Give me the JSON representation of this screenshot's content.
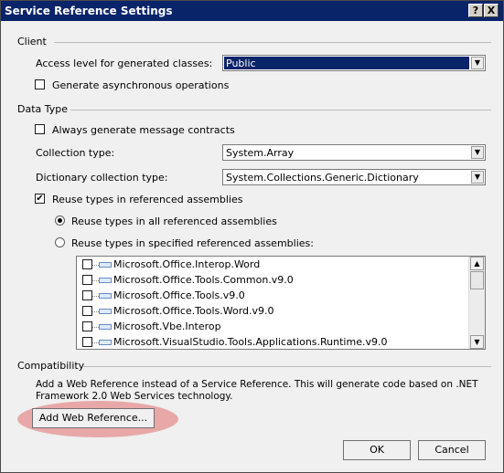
{
  "window": {
    "title": "Service Reference Settings",
    "help_button": "?",
    "close_button": "X"
  },
  "client": {
    "section_label": "Client",
    "access_level_label": "Access level for generated classes:",
    "access_level_value": "Public",
    "async_label": "Generate asynchronous operations",
    "async_checked": false
  },
  "data_type": {
    "section_label": "Data Type",
    "always_generate_label": "Always generate message contracts",
    "always_generate_checked": false,
    "collection_type_label": "Collection type:",
    "collection_type_value": "System.Array",
    "dictionary_type_label": "Dictionary collection type:",
    "dictionary_type_value": "System.Collections.Generic.Dictionary",
    "reuse_types_label": "Reuse types in referenced assemblies",
    "reuse_types_checked": true,
    "reuse_all_label": "Reuse types in all referenced assemblies",
    "reuse_all_selected": true,
    "reuse_specified_label": "Reuse types in specified referenced assemblies:",
    "reuse_specified_selected": false,
    "assemblies": [
      {
        "name": "Microsoft.Office.Interop.Word",
        "checked": false
      },
      {
        "name": "Microsoft.Office.Tools.Common.v9.0",
        "checked": false
      },
      {
        "name": "Microsoft.Office.Tools.v9.0",
        "checked": false
      },
      {
        "name": "Microsoft.Office.Tools.Word.v9.0",
        "checked": false
      },
      {
        "name": "Microsoft.Vbe.Interop",
        "checked": false
      },
      {
        "name": "Microsoft.VisualStudio.Tools.Applications.Runtime.v9.0",
        "checked": false
      }
    ]
  },
  "compatibility": {
    "section_label": "Compatibility",
    "description_line1": "Add a Web Reference instead of a Service Reference. This will generate code based on .NET",
    "description_line2": "Framework 2.0 Web Services technology.",
    "add_web_reference_label": "Add Web Reference..."
  },
  "buttons": {
    "ok_label": "OK",
    "cancel_label": "Cancel"
  },
  "icons": {
    "dropdown": "chevron-down-icon",
    "scroll_up": "arrow-up-icon",
    "scroll_down": "arrow-down-icon",
    "assembly": "assembly-icon"
  },
  "colors": {
    "title_bar": "#0a246a",
    "selection": "#0a246a",
    "highlight_oval": "#e27878"
  }
}
